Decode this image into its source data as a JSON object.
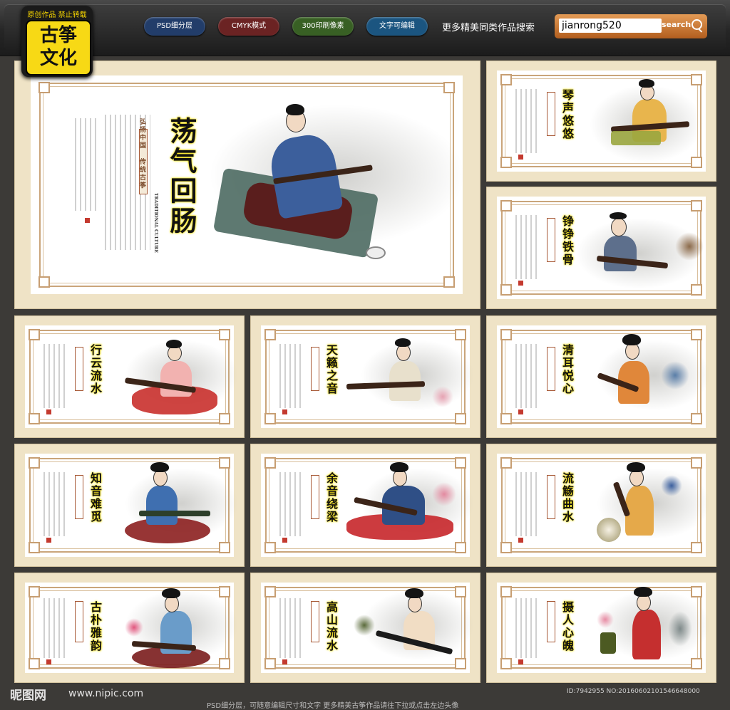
{
  "logo": {
    "top_text": "原创作品 禁止转载",
    "main_text": "古筝文化"
  },
  "tags": [
    {
      "label": "PSD细分层",
      "color": "#2c4a7a"
    },
    {
      "label": "CMYK模式",
      "color": "#7a2a2a"
    },
    {
      "label": "300印刷像素",
      "color": "#3f6a2a"
    },
    {
      "label": "文字可编辑",
      "color": "#1f5e8a"
    }
  ],
  "more_link": "更多精美同类作品搜索",
  "search": {
    "value": "jianrong520",
    "button": "search"
  },
  "panels": [
    {
      "title": "荡气回肠",
      "side": "弘扬中国 传统古筝",
      "en": "TRADITIONAL CULTURE"
    },
    {
      "title": "琴声悠悠"
    },
    {
      "title": "铮铮铁骨"
    },
    {
      "title": "行云流水"
    },
    {
      "title": "天籁之音"
    },
    {
      "title": "清耳悦心"
    },
    {
      "title": "知音难觅"
    },
    {
      "title": "余音绕梁"
    },
    {
      "title": "流觞曲水"
    },
    {
      "title": "古朴雅韵"
    },
    {
      "title": "高山流水"
    },
    {
      "title": "摄人心魄"
    }
  ],
  "footer": {
    "site": "昵图网",
    "url": "www.nipic.com",
    "id": "ID:7942955 NO:20160602101546648000",
    "note": "PSD细分层，可随意编辑尺寸和文字 更多精美古筝作品请往下拉或点击左边头像"
  },
  "colors": {
    "frame": "#efe3c6",
    "border": "#caa57a",
    "title_glow": "#f5e000"
  }
}
